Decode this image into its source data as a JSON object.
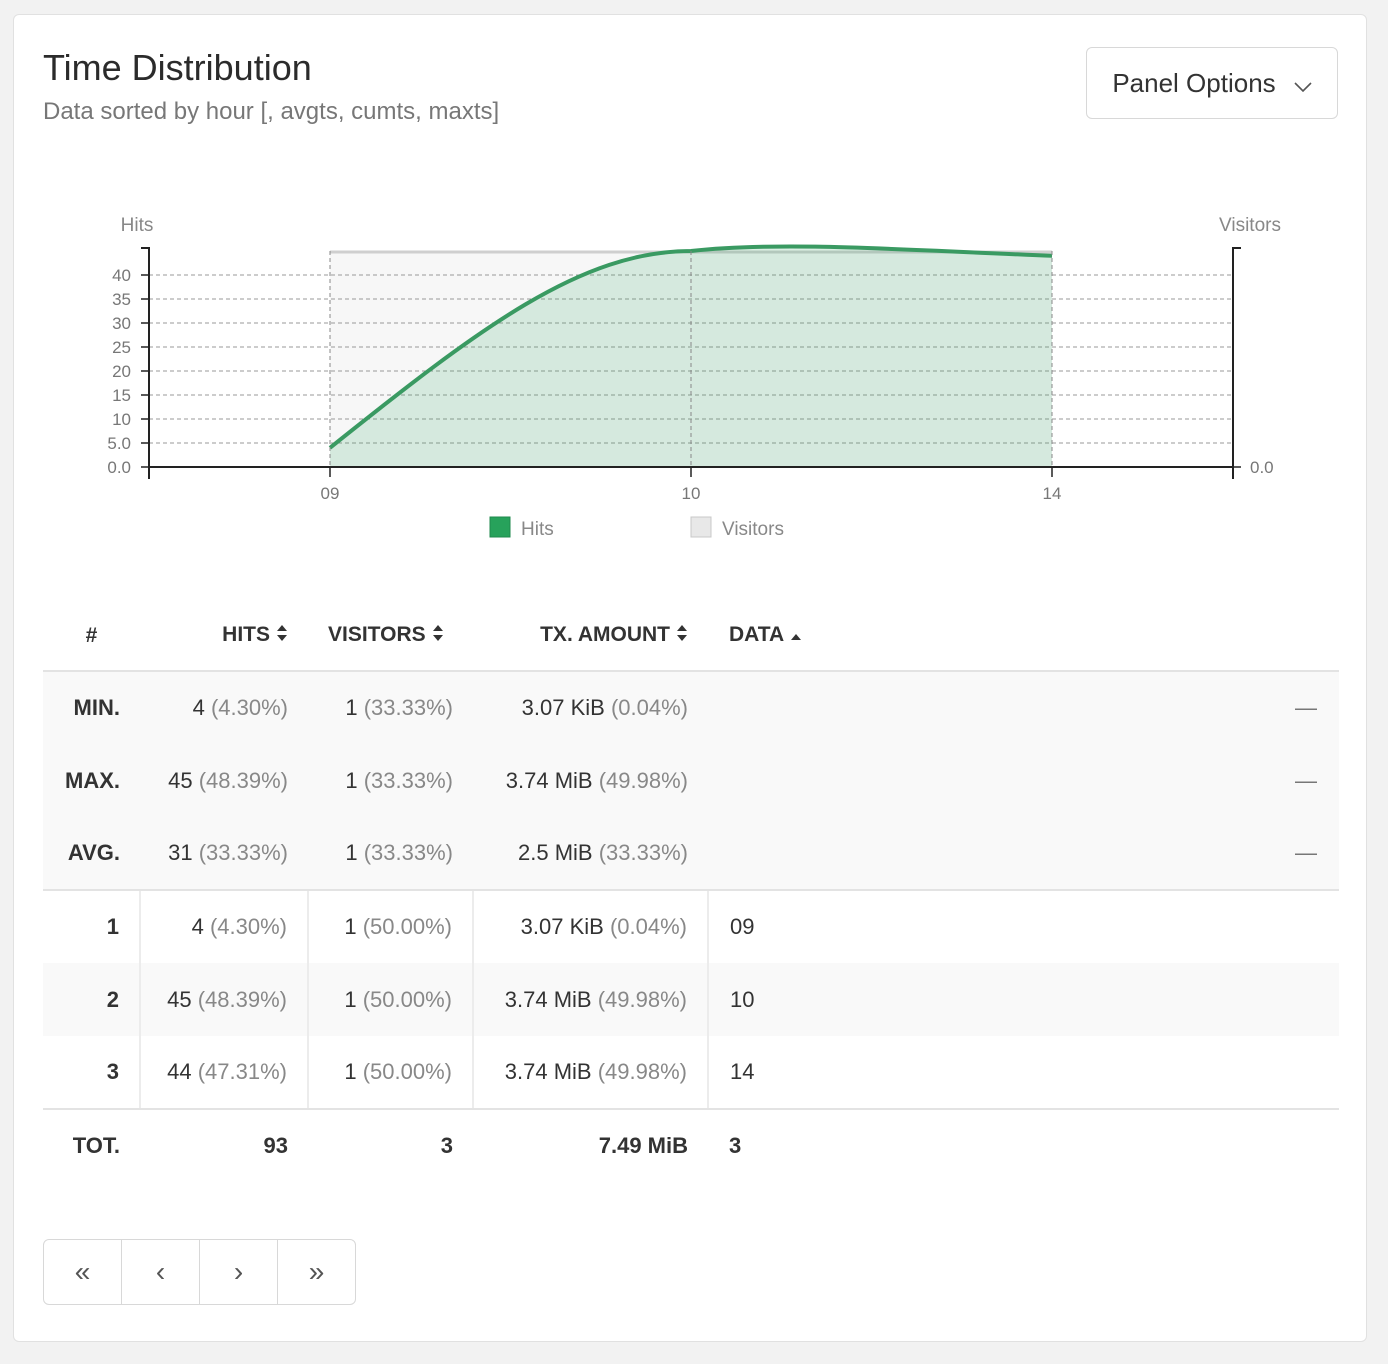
{
  "panel": {
    "title": "Time Distribution",
    "subtitle": "Data sorted by hour [, avgts, cumts, maxts]",
    "options_label": "Panel Options"
  },
  "chart_data": {
    "type": "area",
    "x": [
      "09",
      "10",
      "14"
    ],
    "series": [
      {
        "name": "Hits",
        "values": [
          4,
          45,
          44
        ],
        "color": "#27a25b",
        "axis": "left"
      },
      {
        "name": "Visitors",
        "values": [
          1,
          1,
          1
        ],
        "color": "#d9d9d9",
        "axis": "right"
      }
    ],
    "left_axis": {
      "label": "Hits",
      "ylim": [
        0,
        45
      ],
      "ticks": [
        "0.0",
        "5.0",
        "10",
        "15",
        "20",
        "25",
        "30",
        "35",
        "40"
      ]
    },
    "right_axis": {
      "label": "Visitors",
      "ticks": [
        "0.0"
      ]
    },
    "grid": true,
    "legend": "bottom-center"
  },
  "table": {
    "headers": {
      "idx": "#",
      "hits": "HITS",
      "visitors": "VISITORS",
      "tx": "TX. AMOUNT",
      "data": "DATA"
    },
    "meta": [
      {
        "label": "MIN.",
        "hits": "4",
        "hits_pct": "(4.30%)",
        "visitors": "1",
        "visitors_pct": "(33.33%)",
        "tx": "3.07 KiB",
        "tx_pct": "(0.04%)",
        "dash": "—"
      },
      {
        "label": "MAX.",
        "hits": "45",
        "hits_pct": "(48.39%)",
        "visitors": "1",
        "visitors_pct": "(33.33%)",
        "tx": "3.74 MiB",
        "tx_pct": "(49.98%)",
        "dash": "—"
      },
      {
        "label": "AVG.",
        "hits": "31",
        "hits_pct": "(33.33%)",
        "visitors": "1",
        "visitors_pct": "(33.33%)",
        "tx": "2.5 MiB",
        "tx_pct": "(33.33%)",
        "dash": "—"
      }
    ],
    "rows": [
      {
        "idx": "1",
        "hits": "4",
        "hits_pct": "(4.30%)",
        "visitors": "1",
        "visitors_pct": "(50.00%)",
        "tx": "3.07 KiB",
        "tx_pct": "(0.04%)",
        "data": "09"
      },
      {
        "idx": "2",
        "hits": "45",
        "hits_pct": "(48.39%)",
        "visitors": "1",
        "visitors_pct": "(50.00%)",
        "tx": "3.74 MiB",
        "tx_pct": "(49.98%)",
        "data": "10"
      },
      {
        "idx": "3",
        "hits": "44",
        "hits_pct": "(47.31%)",
        "visitors": "1",
        "visitors_pct": "(50.00%)",
        "tx": "3.74 MiB",
        "tx_pct": "(49.98%)",
        "data": "14"
      }
    ],
    "total": {
      "label": "TOT.",
      "hits": "93",
      "visitors": "3",
      "tx": "7.49 MiB",
      "data": "3"
    }
  },
  "pagination": {
    "first": "«",
    "prev": "‹",
    "next": "›",
    "last": "»"
  }
}
